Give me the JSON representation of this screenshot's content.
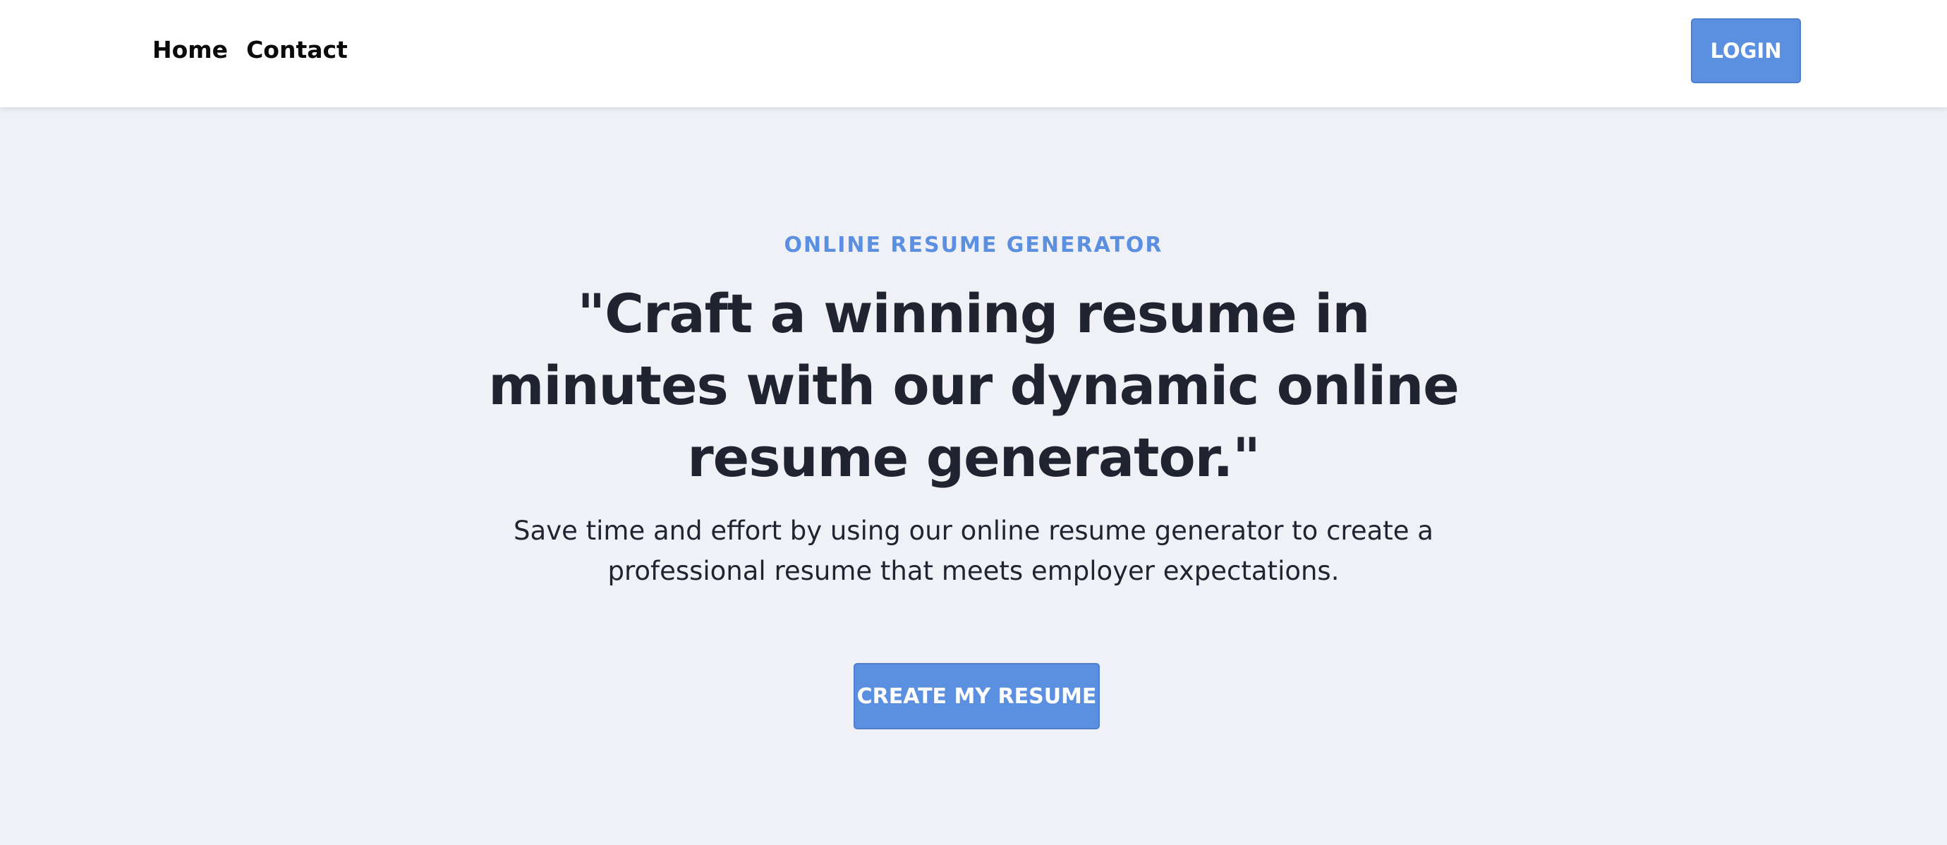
{
  "nav": {
    "links": [
      {
        "label": "Home"
      },
      {
        "label": "Contact"
      }
    ],
    "login_label": "LOGIN"
  },
  "hero": {
    "eyebrow": "ONLINE RESUME GENERATOR",
    "headline": "\"Craft a winning resume in minutes with our dynamic online resume generator.\"",
    "subtext": "Save time and effort by using our online resume generator to create a professional resume that meets employer expectations.",
    "cta_label": "CREATE MY RESUME"
  },
  "colors": {
    "accent": "#5b8fe0",
    "background": "#eff1f6",
    "navbar": "#ffffff",
    "heading_text": "#1f2430"
  }
}
